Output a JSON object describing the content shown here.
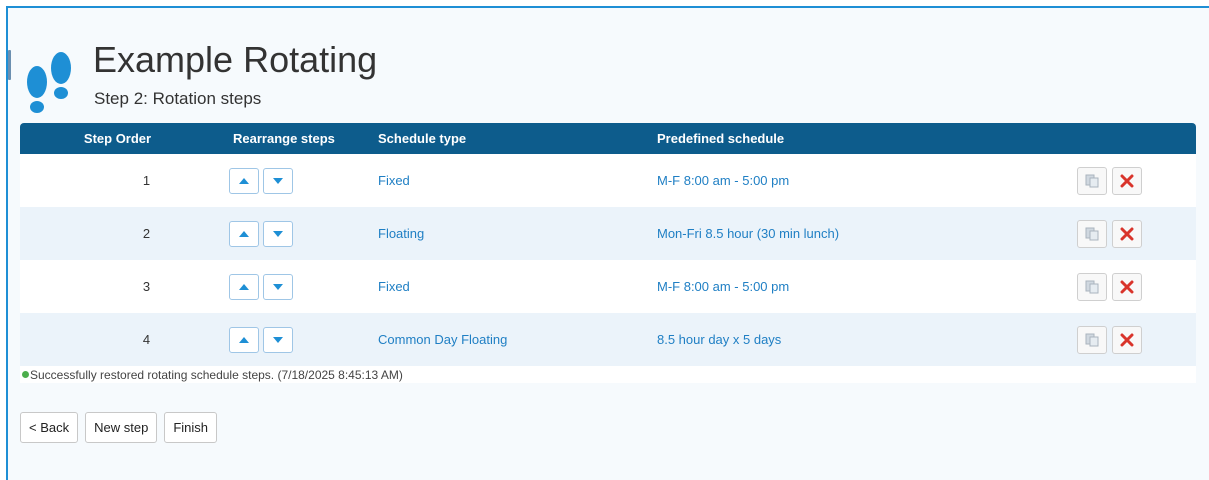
{
  "header": {
    "title": "Example Rotating",
    "subtitle": "Step 2: Rotation steps",
    "icon": "footprints-icon"
  },
  "grid": {
    "columns": [
      "Step Order",
      "Rearrange steps",
      "Schedule type",
      "Predefined schedule"
    ],
    "rows": [
      {
        "order": "1",
        "type": "Fixed",
        "schedule": "M-F 8:00 am - 5:00 pm"
      },
      {
        "order": "2",
        "type": "Floating",
        "schedule": "Mon-Fri 8.5 hour (30 min lunch)"
      },
      {
        "order": "3",
        "type": "Fixed",
        "schedule": "M-F 8:00 am - 5:00 pm"
      },
      {
        "order": "4",
        "type": "Common Day Floating",
        "schedule": "8.5 hour day x 5 days"
      }
    ]
  },
  "status": {
    "message": "Successfully restored rotating schedule steps. (7/18/2025 8:45:13 AM)"
  },
  "buttons": {
    "back": "< Back",
    "new_step": "New step",
    "finish": "Finish"
  },
  "colors": {
    "header_bar": "#0d5c8c",
    "link": "#1f7fc4",
    "accent": "#1e8fd5",
    "delete": "#d9342b",
    "success": "#4cae4c"
  }
}
